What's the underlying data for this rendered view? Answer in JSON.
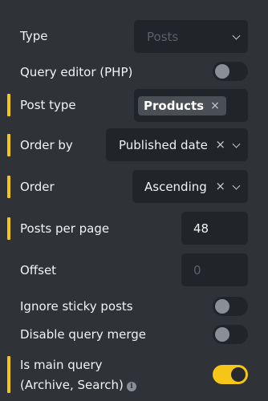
{
  "colors": {
    "background": "#2f3237",
    "control": "#212428",
    "accent": "#f5c518"
  },
  "fields": {
    "type": {
      "label": "Type",
      "placeholder": "Posts"
    },
    "query_editor": {
      "label": "Query editor (PHP)",
      "enabled": false
    },
    "post_type": {
      "label": "Post type",
      "tag": "Products",
      "remove": "×"
    },
    "order_by": {
      "label": "Order by",
      "value": "Published date",
      "clear": "×"
    },
    "order": {
      "label": "Order",
      "value": "Ascending",
      "clear": "×"
    },
    "posts_per_page": {
      "label": "Posts per page",
      "value": "48"
    },
    "offset": {
      "label": "Offset",
      "placeholder": "0"
    },
    "ignore_sticky": {
      "label": "Ignore sticky posts",
      "enabled": false
    },
    "disable_merge": {
      "label": "Disable query merge",
      "enabled": false
    },
    "is_main_query": {
      "label_line1": "Is main query",
      "label_line2": "(Archive, Search)",
      "info_icon": "i",
      "enabled": true
    }
  }
}
